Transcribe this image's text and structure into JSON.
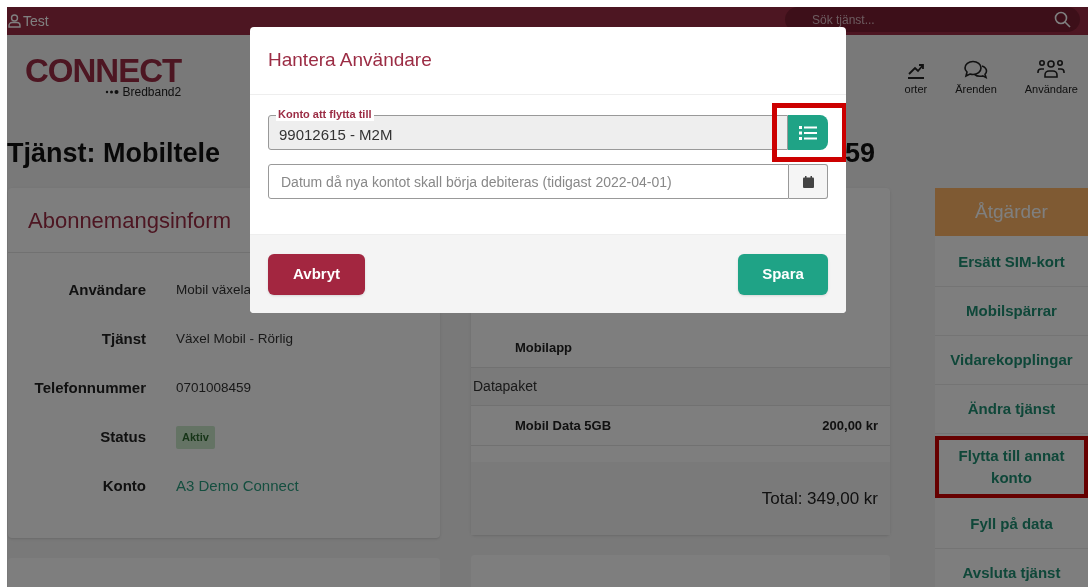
{
  "top_bar": {
    "user": "Test",
    "search": {
      "placeholder": "Sök tjänst..."
    }
  },
  "logo": {
    "wordmark": "CONNECT",
    "tagline": "Bredband2"
  },
  "nav": [
    {
      "kind": "chart",
      "label": "orter"
    },
    {
      "kind": "chat",
      "label": "Ärenden"
    },
    {
      "kind": "users",
      "label": "Användare"
    }
  ],
  "heading_parts": [
    "Tjänst: Mobiltele",
    "59"
  ],
  "subscription_card": {
    "title": "Abonnemangsinform",
    "rows": [
      {
        "kind": "text",
        "label": "Användare",
        "value": "Mobil växela"
      },
      {
        "kind": "text",
        "label": "Tjänst",
        "value": "Växel Mobil - Rörlig"
      },
      {
        "kind": "text",
        "label": "Telefonnummer",
        "value": "0701008459"
      },
      {
        "kind": "badge",
        "label": "Status",
        "value": "Aktiv"
      },
      {
        "kind": "link",
        "label": "Konto",
        "value": "A3 Demo Connect"
      }
    ]
  },
  "products_card": {
    "rows": [
      {
        "kind": "item",
        "name": "Mobilapp"
      },
      {
        "kind": "section",
        "name": "Datapaket"
      },
      {
        "kind": "item",
        "name": "Mobil Data 5GB",
        "price": "200,00 kr"
      }
    ],
    "total": "Total: 349,00 kr"
  },
  "actions": {
    "title": "Åtgärder",
    "items": [
      {
        "label": "Ersätt SIM-kort",
        "highlighted": false
      },
      {
        "label": "Mobilspärrar",
        "highlighted": false
      },
      {
        "label": "Vidarekopplingar",
        "highlighted": false
      },
      {
        "label": "Ändra tjänst",
        "highlighted": false
      },
      {
        "label": "Flytta till annat konto",
        "highlighted": true
      },
      {
        "label": "Fyll på data",
        "highlighted": false
      },
      {
        "label": "Avsluta tjänst",
        "highlighted": false
      }
    ]
  },
  "modal": {
    "title": "Hantera Användare",
    "account_field": {
      "legend": "Konto att flytta till",
      "value": "99012615 - M2M",
      "list_button_highlighted": true
    },
    "date_field": {
      "placeholder": "Datum då nya kontot skall börja debiteras (tidigast 2022-04-01)"
    },
    "cancel_button": "Avbryt",
    "save_button": "Spara"
  }
}
